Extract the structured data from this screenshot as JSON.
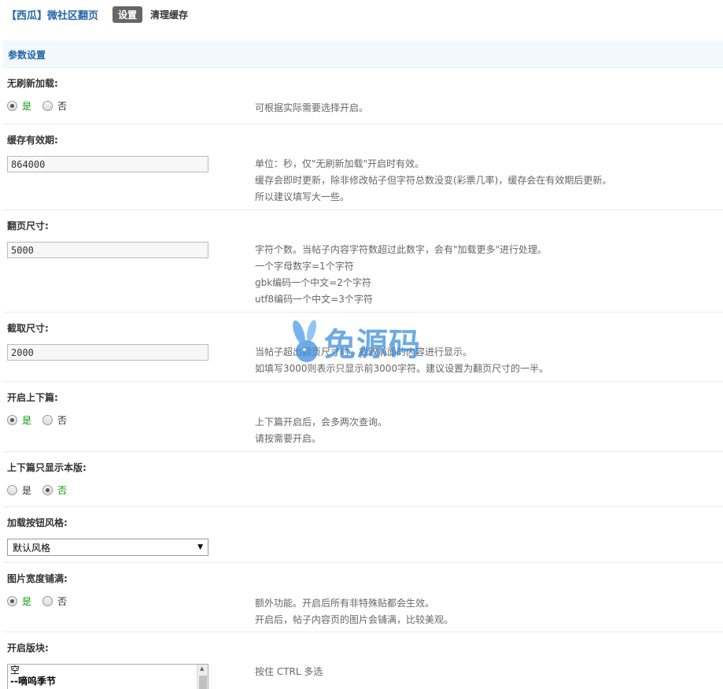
{
  "header": {
    "plugin_title": "【西瓜】微社区翻页",
    "tab_active": "设置",
    "tab_clear": "清理缓存"
  },
  "section": {
    "title": "参数设置"
  },
  "settings": {
    "ajax_load": {
      "label": "无刷新加载:",
      "yes": "是",
      "no": "否",
      "selected": "yes",
      "desc": [
        "可根据实际需要选择开启。"
      ]
    },
    "cache_time": {
      "label": "缓存有效期:",
      "value": "864000",
      "desc": [
        "单位：秒，仅\"无刷新加载\"开启时有效。",
        "缓存会即时更新，除非修改帖子但字符总数没变(彩票几率)，缓存会在有效期后更新。",
        "所以建议填写大一些。"
      ]
    },
    "page_size": {
      "label": "翻页尺寸:",
      "value": "5000",
      "desc": [
        "字符个数。当帖子内容字符数超过此数字，会有\"加载更多\"进行处理。",
        "一个字母数字=1个字符",
        "gbk编码一个中文=2个字符",
        "utf8编码一个中文=3个字符"
      ]
    },
    "cut_size": {
      "label": "截取尺寸:",
      "value": "2000",
      "desc": [
        "当帖子超出翻页尺寸时，截取前面的内容进行显示。",
        "如填写3000则表示只显示前3000字符。建议设置为翻页尺寸的一半。"
      ]
    },
    "prev_next": {
      "label": "开启上下篇:",
      "yes": "是",
      "no": "否",
      "selected": "yes",
      "desc": [
        "上下篇开启后，会多两次查询。",
        "请按需要开启。"
      ]
    },
    "prev_next_forum": {
      "label": "上下篇只显示本版:",
      "yes": "是",
      "no": "否",
      "selected": "no",
      "desc": []
    },
    "button_style": {
      "label": "加载按钮风格:",
      "selected_option": "默认风格",
      "desc": []
    },
    "image_full": {
      "label": "图片宽度铺满:",
      "yes": "是",
      "no": "否",
      "selected": "yes",
      "desc": [
        "额外功能。开启后所有非特殊贴都会生效。",
        "开启后，帖子内容页的图片会铺满，比较美观。"
      ]
    },
    "forums": {
      "label": "开启版块:",
      "options": [
        "空",
        "--嘀呜季节"
      ],
      "desc": [
        "按住 CTRL 多选"
      ]
    }
  },
  "watermark": {
    "text": "兔源码"
  },
  "colors": {
    "accent": "#2366a8",
    "section_bg": "#f2f9fd",
    "checked_text": "#099a08"
  }
}
